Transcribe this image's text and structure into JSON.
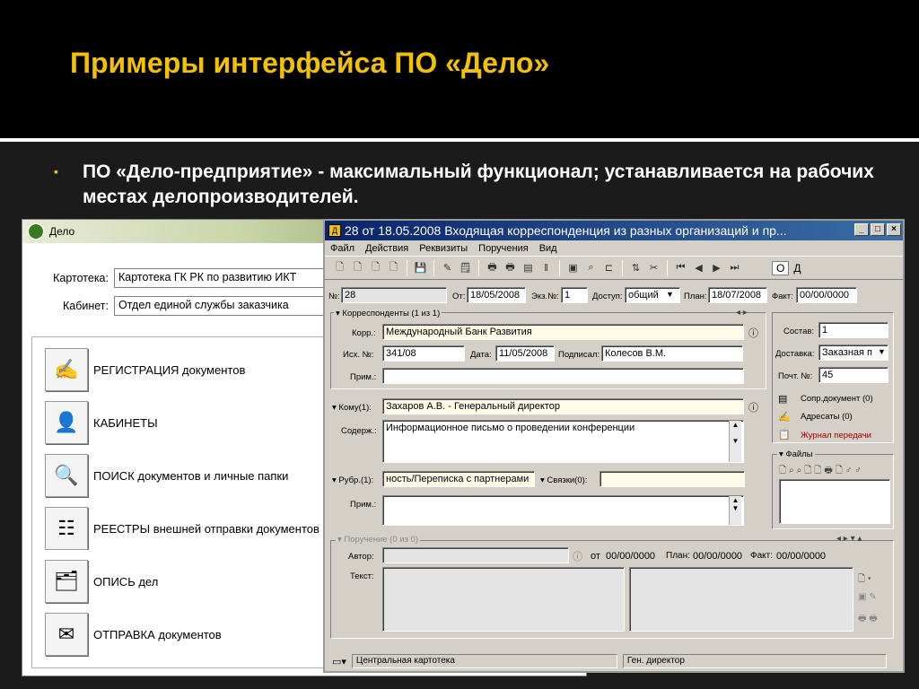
{
  "slide": {
    "title": "Примеры интерфейса ПО «Дело»",
    "bullet": "ПО «Дело-предприятие» - максимальный функционал; устанавливается на рабочих местах делопроизводителей."
  },
  "back_window": {
    "title": "Дело",
    "kartoteka_label": "Картотека:",
    "kartoteka_value": "Картотека ГК РК по развитию ИКТ",
    "kabinet_label": "Кабинет:",
    "kabinet_value": "Отдел единой службы заказчика",
    "menu": [
      {
        "label": "РЕГИСТРАЦИЯ  документов",
        "icon": "registration-icon"
      },
      {
        "label": "КАБИНЕТЫ",
        "icon": "cabinet-icon"
      },
      {
        "label": "ПОИСК  документов и личные папки",
        "icon": "search-icon"
      },
      {
        "label": "РЕЕСТРЫ  внешней отправки документов",
        "icon": "registry-icon"
      },
      {
        "label": "ОПИСЬ дел",
        "icon": "inventory-icon"
      },
      {
        "label": "ОТПРАВКА документов",
        "icon": "send-icon"
      }
    ]
  },
  "front_window": {
    "title": "28 от 18.05.2008 Входящая корреспонденция из разных организаций и пр...",
    "menu": [
      "Файл",
      "Действия",
      "Реквизиты",
      "Поручения",
      "Вид"
    ],
    "toolbar_od": "О",
    "toolbar_d": "Д",
    "num_label": "№:",
    "num_value": "28",
    "from_label": "От:",
    "from_value": "18/05/2008",
    "copy_label": "Экз.№:",
    "copy_value": "1",
    "access_label": "Доступ:",
    "access_value": "общий",
    "plan_label": "План:",
    "plan_value": "18/07/2008",
    "fact_label": "Факт:",
    "fact_value": "00/00/0000",
    "corr_header": "Корреспонденты (1 из 1)",
    "korr_label": "Корр.:",
    "korr_value": "Международный Банк Развития",
    "ish_label": "Исх. №:",
    "ish_value": "341/08",
    "date_label": "Дата:",
    "date_value": "11/05/2008",
    "signed_label": "Подписал:",
    "signed_value": "Колесов В.М.",
    "prim_label": "Прим.:",
    "prim_value": "",
    "sostav_label": "Состав:",
    "sostav_value": "1",
    "delivery_label": "Доставка:",
    "delivery_value": "Заказная п",
    "post_label": "Почт. №:",
    "post_value": "45",
    "links": [
      "Сопр.документ (0)",
      "Адресаты (0)",
      "Журнал передачи"
    ],
    "komu_label": "Кому(1):",
    "komu_value": "Захаров А.В. - Генеральный директор",
    "soderzh_label": "Содерж.:",
    "soderzh_value": "Информационное письмо о проведении конференции",
    "files_label": "Файлы",
    "rubr_label": "Рубр.(1):",
    "rubr_value": "ность/Переписка с партнерами",
    "svyazki_label": "Связки(0):",
    "prim2_label": "Прим.:",
    "poruch_header": "Поручение (0 из 0)",
    "avtor_label": "Автор:",
    "ot_label": "от",
    "ot_value": "00/00/0000",
    "p_plan_label": "План:",
    "p_plan_value": "00/00/0000",
    "p_fact_label": "Факт:",
    "p_fact_value": "00/00/0000",
    "text_label": "Текст:",
    "status_left": "Центральная картотека",
    "status_right": "Ген. директор"
  }
}
